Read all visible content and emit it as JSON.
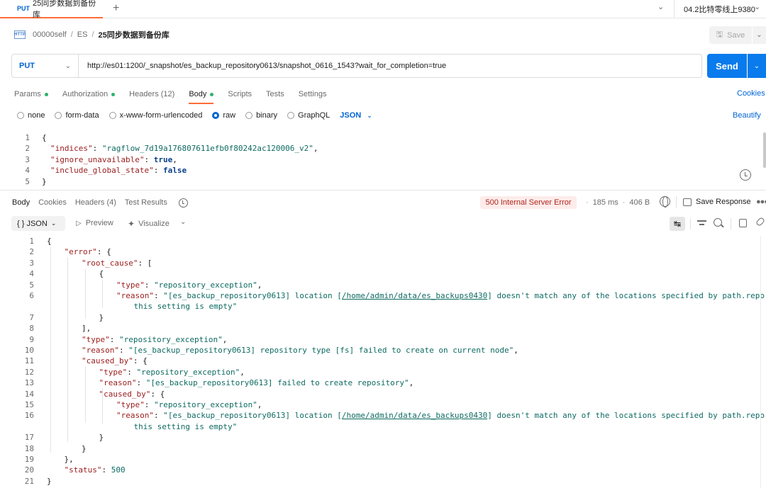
{
  "tab": {
    "method": "PUT",
    "title": "25同步数据到备份库"
  },
  "environment": {
    "name": "04.2比特零线上9380"
  },
  "breadcrumb": {
    "icon_text": "HTTP",
    "workspace": "00000self",
    "collection": "ES",
    "current": "25同步数据到备份库"
  },
  "save": {
    "label": "Save"
  },
  "request": {
    "method": "PUT",
    "url": "http://es01:1200/_snapshot/es_backup_repository0613/snapshot_0616_1543?wait_for_completion=true",
    "send_label": "Send",
    "tabs": [
      {
        "label": "Params",
        "dot": true
      },
      {
        "label": "Authorization",
        "dot": true
      },
      {
        "label": "Headers (12)",
        "dot": false
      },
      {
        "label": "Body",
        "dot": true
      },
      {
        "label": "Scripts",
        "dot": false
      },
      {
        "label": "Tests",
        "dot": false
      },
      {
        "label": "Settings",
        "dot": false
      }
    ],
    "cookies_label": "Cookies",
    "body_types": [
      "none",
      "form-data",
      "x-www-form-urlencoded",
      "raw",
      "binary",
      "GraphQL"
    ],
    "selected_body_type": "raw",
    "body_format": "JSON",
    "beautify_label": "Beautify",
    "body_lines": [
      {
        "n": "1",
        "indent": 0,
        "parts": [
          [
            "p",
            "{"
          ]
        ]
      },
      {
        "n": "2",
        "indent": 1,
        "parts": [
          [
            "k",
            "\"indices\""
          ],
          [
            "p",
            ": "
          ],
          [
            "s",
            "\"ragflow_7d19a176807611efb0f80242ac120006_v2\""
          ],
          [
            "p",
            ","
          ]
        ]
      },
      {
        "n": "3",
        "indent": 1,
        "parts": [
          [
            "k",
            "\"ignore_unavailable\""
          ],
          [
            "p",
            ": "
          ],
          [
            "kw",
            "true"
          ],
          [
            "p",
            ","
          ]
        ]
      },
      {
        "n": "4",
        "indent": 1,
        "parts": [
          [
            "k",
            "\"include_global_state\""
          ],
          [
            "p",
            ": "
          ],
          [
            "kw",
            "false"
          ]
        ]
      },
      {
        "n": "5",
        "indent": 0,
        "parts": [
          [
            "p",
            "}"
          ]
        ]
      }
    ]
  },
  "response": {
    "tabs": [
      {
        "label": "Body"
      },
      {
        "label": "Cookies"
      },
      {
        "label": "Headers (4)"
      },
      {
        "label": "Test Results"
      }
    ],
    "status": "500 Internal Server Error",
    "time": "185 ms",
    "size": "406 B",
    "save_response_label": "Save Response",
    "format": "JSON",
    "preview_label": "Preview",
    "visualize_label": "Visualize",
    "lines": [
      {
        "n": "1",
        "indent": 0,
        "parts": [
          [
            "p",
            "{"
          ]
        ]
      },
      {
        "n": "2",
        "indent": 1,
        "parts": [
          [
            "k",
            "\"error\""
          ],
          [
            "p",
            ": {"
          ]
        ]
      },
      {
        "n": "3",
        "indent": 2,
        "parts": [
          [
            "k",
            "\"root_cause\""
          ],
          [
            "p",
            ": ["
          ]
        ]
      },
      {
        "n": "4",
        "indent": 3,
        "parts": [
          [
            "p",
            "{"
          ]
        ]
      },
      {
        "n": "5",
        "indent": 4,
        "parts": [
          [
            "k",
            "\"type\""
          ],
          [
            "p",
            ": "
          ],
          [
            "s",
            "\"repository_exception\""
          ],
          [
            "p",
            ","
          ]
        ]
      },
      {
        "n": "6",
        "indent": 4,
        "parts": [
          [
            "k",
            "\"reason\""
          ],
          [
            "p",
            ": "
          ],
          [
            "s",
            "\"[es_backup_repository0613] location ["
          ],
          [
            "u",
            "/home/admin/data/es_backups0430"
          ],
          [
            "s",
            "] doesn't match any of the locations specified by path.repo because"
          ]
        ]
      },
      {
        "n": "",
        "indent": 5,
        "parts": [
          [
            "s",
            "this setting is empty\""
          ]
        ]
      },
      {
        "n": "7",
        "indent": 3,
        "parts": [
          [
            "p",
            "}"
          ]
        ]
      },
      {
        "n": "8",
        "indent": 2,
        "parts": [
          [
            "p",
            "],"
          ]
        ]
      },
      {
        "n": "9",
        "indent": 2,
        "parts": [
          [
            "k",
            "\"type\""
          ],
          [
            "p",
            ": "
          ],
          [
            "s",
            "\"repository_exception\""
          ],
          [
            "p",
            ","
          ]
        ]
      },
      {
        "n": "10",
        "indent": 2,
        "parts": [
          [
            "k",
            "\"reason\""
          ],
          [
            "p",
            ": "
          ],
          [
            "s",
            "\"[es_backup_repository0613] repository type [fs] failed to create on current node\""
          ],
          [
            "p",
            ","
          ]
        ]
      },
      {
        "n": "11",
        "indent": 2,
        "parts": [
          [
            "k",
            "\"caused_by\""
          ],
          [
            "p",
            ": {"
          ]
        ]
      },
      {
        "n": "12",
        "indent": 3,
        "parts": [
          [
            "k",
            "\"type\""
          ],
          [
            "p",
            ": "
          ],
          [
            "s",
            "\"repository_exception\""
          ],
          [
            "p",
            ","
          ]
        ]
      },
      {
        "n": "13",
        "indent": 3,
        "parts": [
          [
            "k",
            "\"reason\""
          ],
          [
            "p",
            ": "
          ],
          [
            "s",
            "\"[es_backup_repository0613] failed to create repository\""
          ],
          [
            "p",
            ","
          ]
        ]
      },
      {
        "n": "14",
        "indent": 3,
        "parts": [
          [
            "k",
            "\"caused_by\""
          ],
          [
            "p",
            ": {"
          ]
        ]
      },
      {
        "n": "15",
        "indent": 4,
        "parts": [
          [
            "k",
            "\"type\""
          ],
          [
            "p",
            ": "
          ],
          [
            "s",
            "\"repository_exception\""
          ],
          [
            "p",
            ","
          ]
        ]
      },
      {
        "n": "16",
        "indent": 4,
        "parts": [
          [
            "k",
            "\"reason\""
          ],
          [
            "p",
            ": "
          ],
          [
            "s",
            "\"[es_backup_repository0613] location ["
          ],
          [
            "u",
            "/home/admin/data/es_backups0430"
          ],
          [
            "s",
            "] doesn't match any of the locations specified by path.repo because"
          ]
        ]
      },
      {
        "n": "",
        "indent": 5,
        "parts": [
          [
            "s",
            "this setting is empty\""
          ]
        ]
      },
      {
        "n": "17",
        "indent": 3,
        "parts": [
          [
            "p",
            "}"
          ]
        ]
      },
      {
        "n": "18",
        "indent": 2,
        "parts": [
          [
            "p",
            "}"
          ]
        ]
      },
      {
        "n": "19",
        "indent": 1,
        "parts": [
          [
            "p",
            "},"
          ]
        ]
      },
      {
        "n": "20",
        "indent": 1,
        "parts": [
          [
            "k",
            "\"status\""
          ],
          [
            "p",
            ": "
          ],
          [
            "num",
            "500"
          ]
        ]
      },
      {
        "n": "21",
        "indent": 0,
        "parts": [
          [
            "p",
            "}"
          ]
        ]
      }
    ]
  },
  "colors": {
    "accent": "#ff6c37",
    "send": "#097bed",
    "method": "#0265d2",
    "error": "#b0261e"
  }
}
